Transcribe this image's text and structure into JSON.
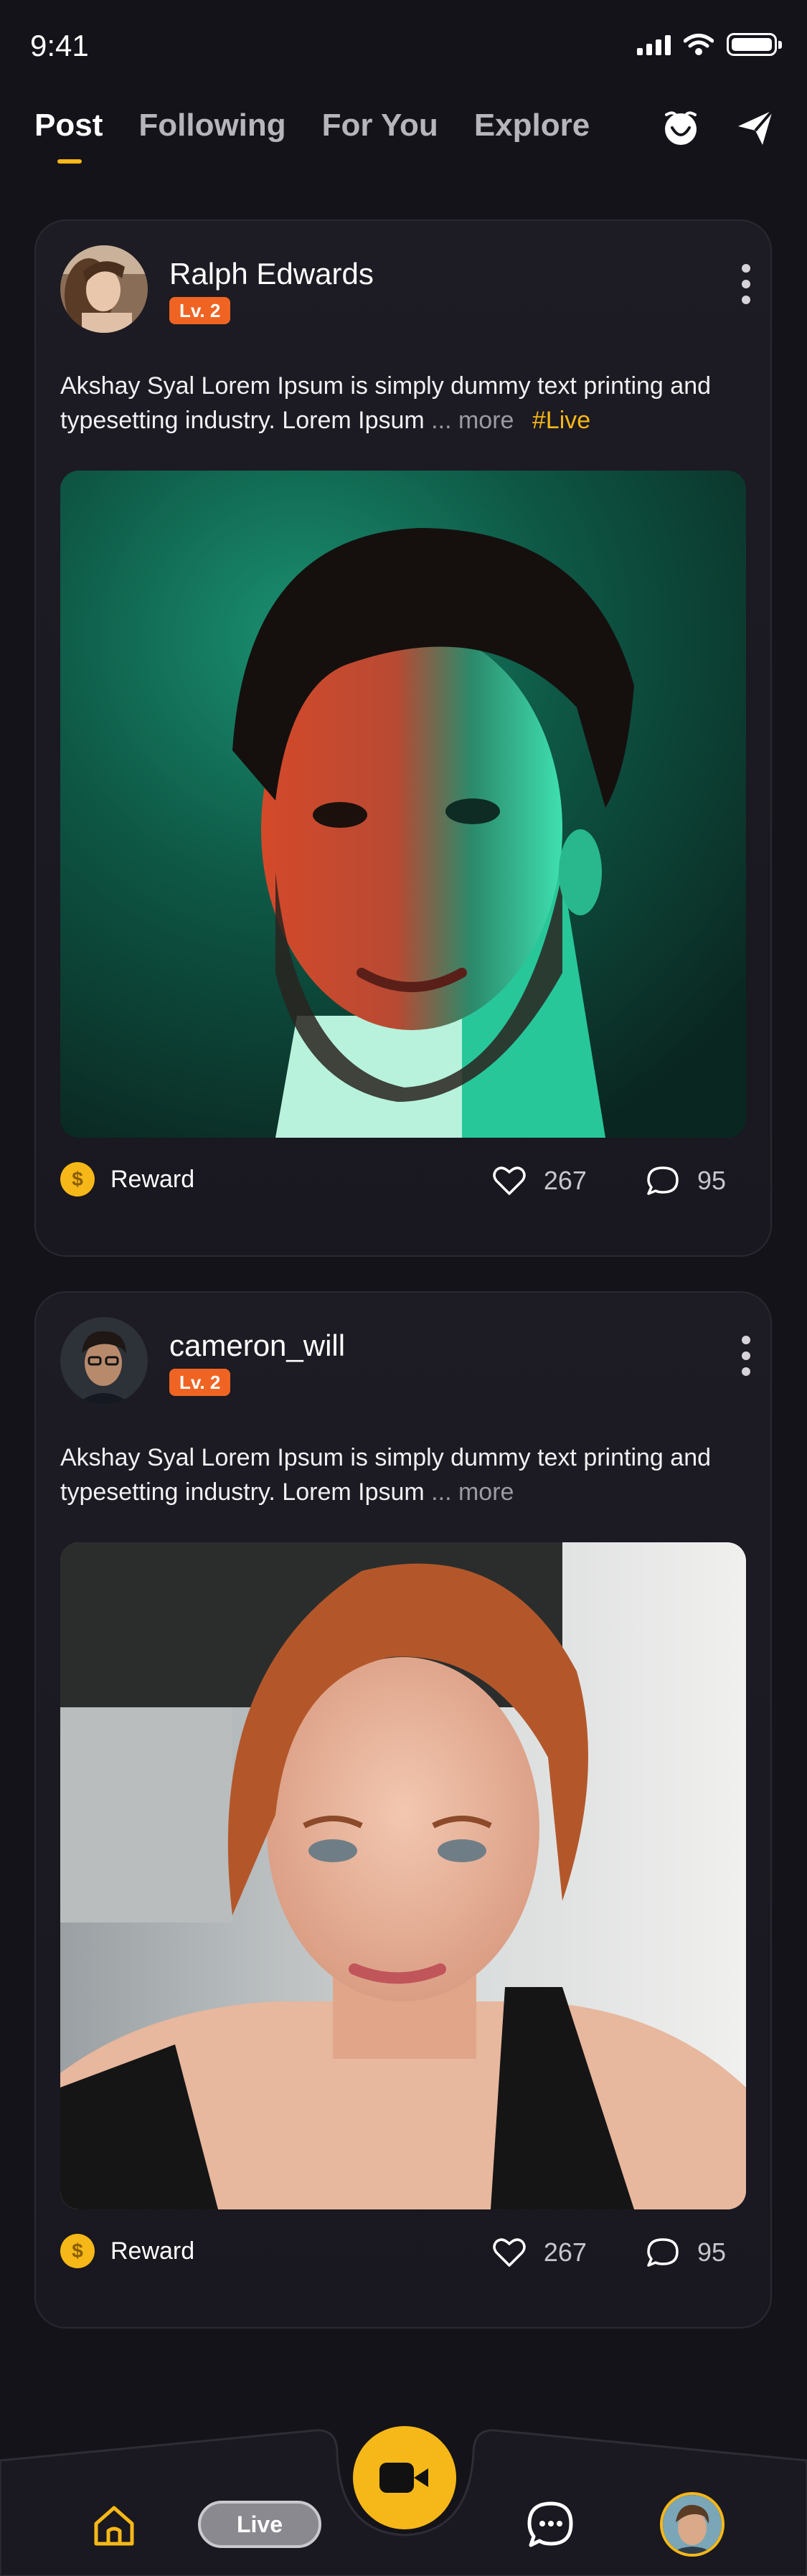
{
  "status_bar": {
    "time": "9:41"
  },
  "top_nav": {
    "tabs": [
      {
        "label": "Post",
        "active": true
      },
      {
        "label": "Following",
        "active": false
      },
      {
        "label": "For You",
        "active": false
      },
      {
        "label": "Explore",
        "active": false
      }
    ],
    "icons": [
      "notification-icon",
      "send-icon"
    ]
  },
  "posts": [
    {
      "username": "Ralph Edwards",
      "level": "Lv. 2",
      "text": "Akshay Syal Lorem Ipsum is simply dummy text printing and typesetting industry. Lorem Ipsum",
      "more_label": "... more",
      "hashtag": "#Live",
      "reward_label": "Reward",
      "likes": "267",
      "comments": "95"
    },
    {
      "username": "cameron_will",
      "level": "Lv. 2",
      "text": "Akshay Syal Lorem Ipsum is simply dummy text printing and typesetting industry. Lorem Ipsum",
      "more_label": "... more",
      "hashtag": "",
      "reward_label": "Reward",
      "likes": "267",
      "comments": "95"
    }
  ],
  "bottom_nav": {
    "live_label": "Live",
    "items": [
      "home-icon",
      "live-button",
      "go-live-camera-icon",
      "messages-icon",
      "profile-avatar"
    ]
  },
  "colors": {
    "accent": "#f6b818",
    "badge": "#f06423",
    "background": "#15131a",
    "card": "#1d1b23"
  },
  "coin_symbol": "$"
}
